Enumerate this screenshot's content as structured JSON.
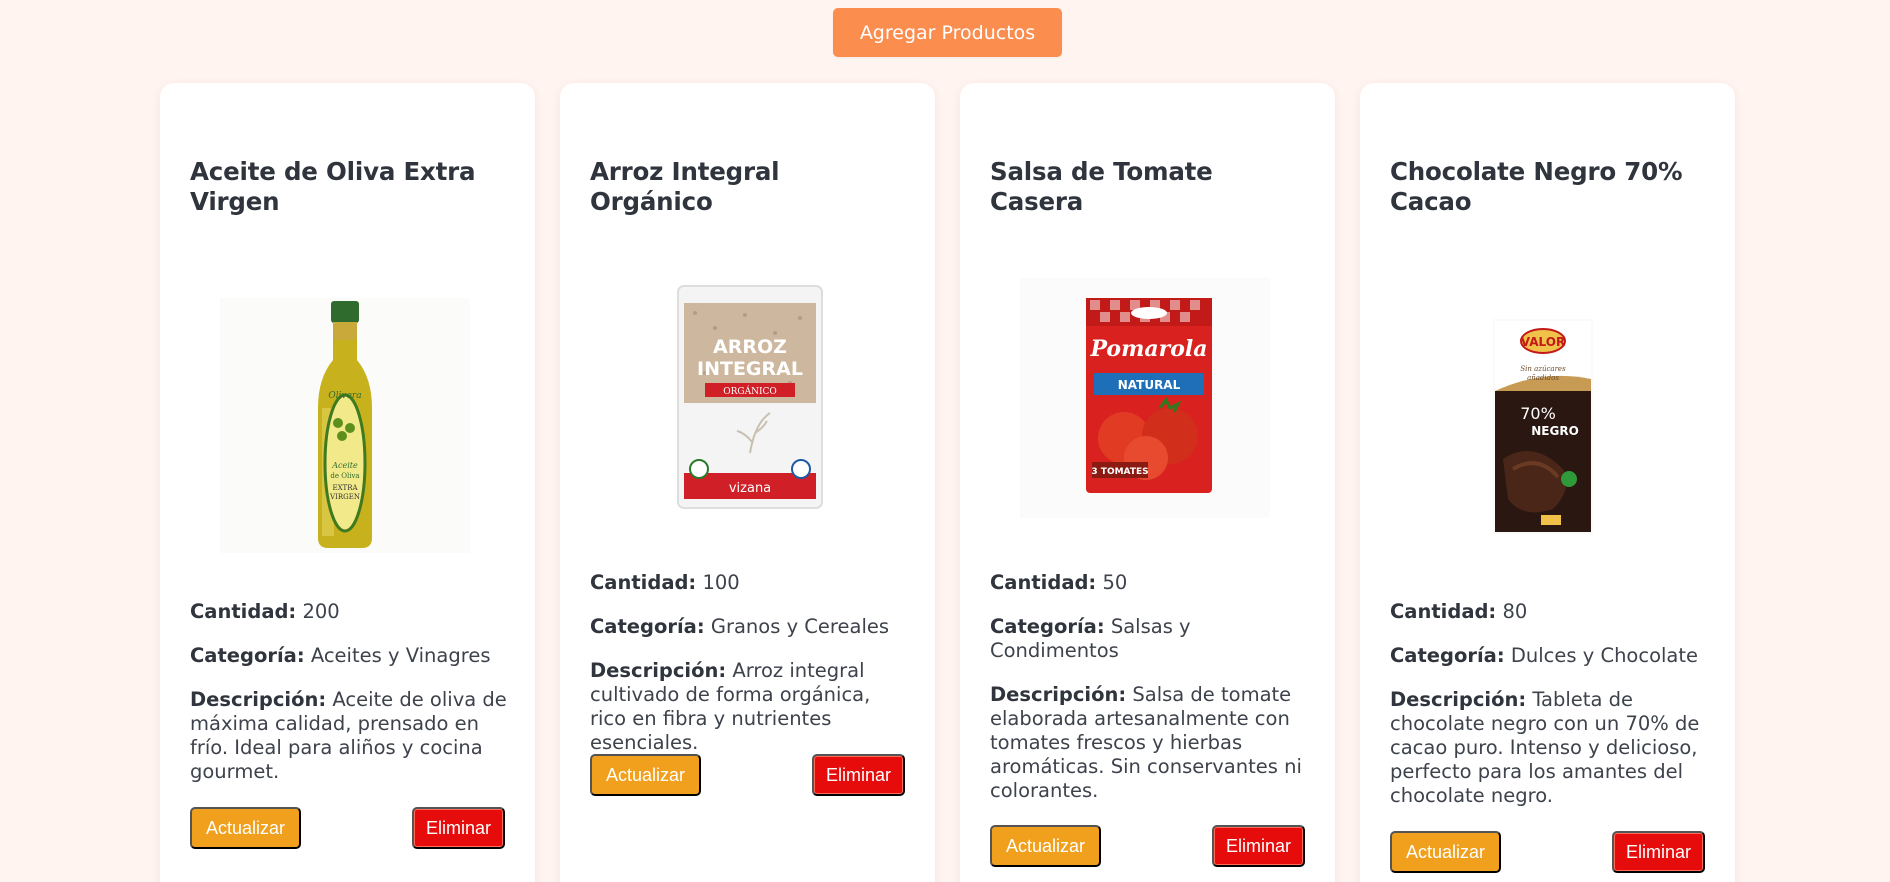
{
  "header": {
    "add_button_label": "Agregar Productos"
  },
  "labels": {
    "quantity": "Cantidad:",
    "category": "Categoría:",
    "description": "Descripción:",
    "update": "Actualizar",
    "delete": "Eliminar"
  },
  "products": [
    {
      "name": "Aceite de Oliva Extra Virgen",
      "quantity": "200",
      "category": "Aceites y Vinagres",
      "description": "Aceite de oliva de máxima calidad, prensado en frío. Ideal para aliños y cocina gourmet.",
      "image_icon": "olive-oil-bottle-image",
      "brand_text": "Olivera",
      "label_text": "Aceite de Oliva EXTRA VIRGEN"
    },
    {
      "name": "Arroz Integral Orgánico",
      "quantity": "100",
      "category": "Granos y Cereales",
      "description": "Arroz integral cultivado de forma orgánica, rico en fibra y nutrientes esenciales.",
      "image_icon": "brown-rice-bag-image",
      "brand_text": "vizana",
      "label_text": "ARROZ INTEGRAL",
      "sub_label": "ORGÁNICO"
    },
    {
      "name": "Salsa de Tomate Casera",
      "quantity": "50",
      "category": "Salsas y Condimentos",
      "description": "Salsa de tomate elaborada artesanalmente con tomates frescos y hierbas aromáticas. Sin conservantes ni colorantes.",
      "image_icon": "tomato-sauce-pouch-image",
      "brand_text": "Pomarola",
      "label_text": "NATURAL",
      "sub_label": "3 TOMATES"
    },
    {
      "name": "Chocolate Negro 70% Cacao",
      "quantity": "80",
      "category": "Dulces y Chocolate",
      "description": "Tableta de chocolate negro con un 70% de cacao puro. Intenso y delicioso, perfecto para los amantes del chocolate negro.",
      "image_icon": "dark-chocolate-bar-image",
      "brand_text": "VALOR",
      "label_text": "70% NEGRO",
      "sub_label": "Sin azúcares añadidos"
    }
  ]
}
